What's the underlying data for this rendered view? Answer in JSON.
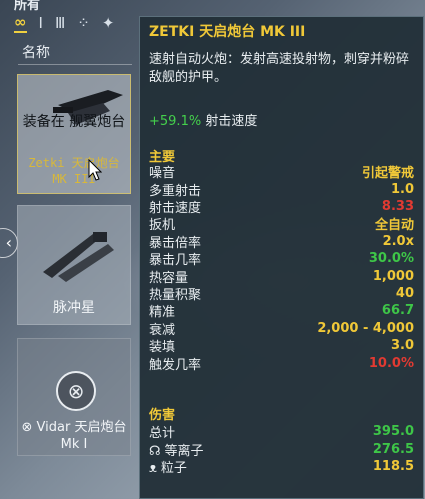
{
  "header": {
    "title": "所有"
  },
  "filters": {
    "items": [
      {
        "label": "∞",
        "active": true
      },
      {
        "label": "Ⅰ",
        "active": false
      },
      {
        "label": "Ⅲ",
        "active": false
      },
      {
        "label": "⁘",
        "active": false
      },
      {
        "label": "✦",
        "active": false
      }
    ]
  },
  "list": {
    "column_header": "名称",
    "cards": [
      {
        "equip_label": "装备在 舰翼炮台",
        "name": "Zetki 天启炮台 MK III"
      },
      {
        "name": "脉冲星"
      },
      {
        "name": "⊗ Vidar 天启炮台 Mk I"
      }
    ]
  },
  "tooltip": {
    "title": "ZETKI 天启炮台 MK III",
    "description": "速射自动火炮：发射高速投射物，刺穿并粉碎敌舰的护甲。",
    "bonus_value": "+59.1%",
    "bonus_label": "射击速度",
    "main_section": "主要",
    "stats": [
      {
        "label": "噪音",
        "value": "引起警戒",
        "color": "yellow"
      },
      {
        "label": "多重射击",
        "value": "1.0",
        "color": "yellow"
      },
      {
        "label": "射击速度",
        "value": "8.33",
        "color": "red"
      },
      {
        "label": "扳机",
        "value": "全自动",
        "color": "yellow"
      },
      {
        "label": "暴击倍率",
        "value": "2.0x",
        "color": "yellow"
      },
      {
        "label": "暴击几率",
        "value": "30.0%",
        "color": "green"
      },
      {
        "label": "热容量",
        "value": "1,000",
        "color": "yellow"
      },
      {
        "label": "热量积聚",
        "value": "40",
        "color": "yellow"
      },
      {
        "label": "精准",
        "value": "66.7",
        "color": "green"
      },
      {
        "label": "衰减",
        "value": "2,000 - 4,000",
        "color": "yellow"
      },
      {
        "label": "装填",
        "value": "3.0",
        "color": "yellow"
      },
      {
        "label": "触发几率",
        "value": "10.0%",
        "color": "red"
      }
    ],
    "damage_section": "伤害",
    "damage": [
      {
        "icon": "",
        "label": "总计",
        "value": "395.0",
        "color": "green"
      },
      {
        "icon": "☊",
        "label": "等离子",
        "value": "276.5",
        "color": "green"
      },
      {
        "icon": "ᴥ",
        "label": "粒子",
        "value": "118.5",
        "color": "yellow"
      }
    ]
  },
  "colors": {
    "accent": "#f0c838",
    "positive": "#3ec648",
    "negative": "#e23a32",
    "panel": "#223038"
  }
}
